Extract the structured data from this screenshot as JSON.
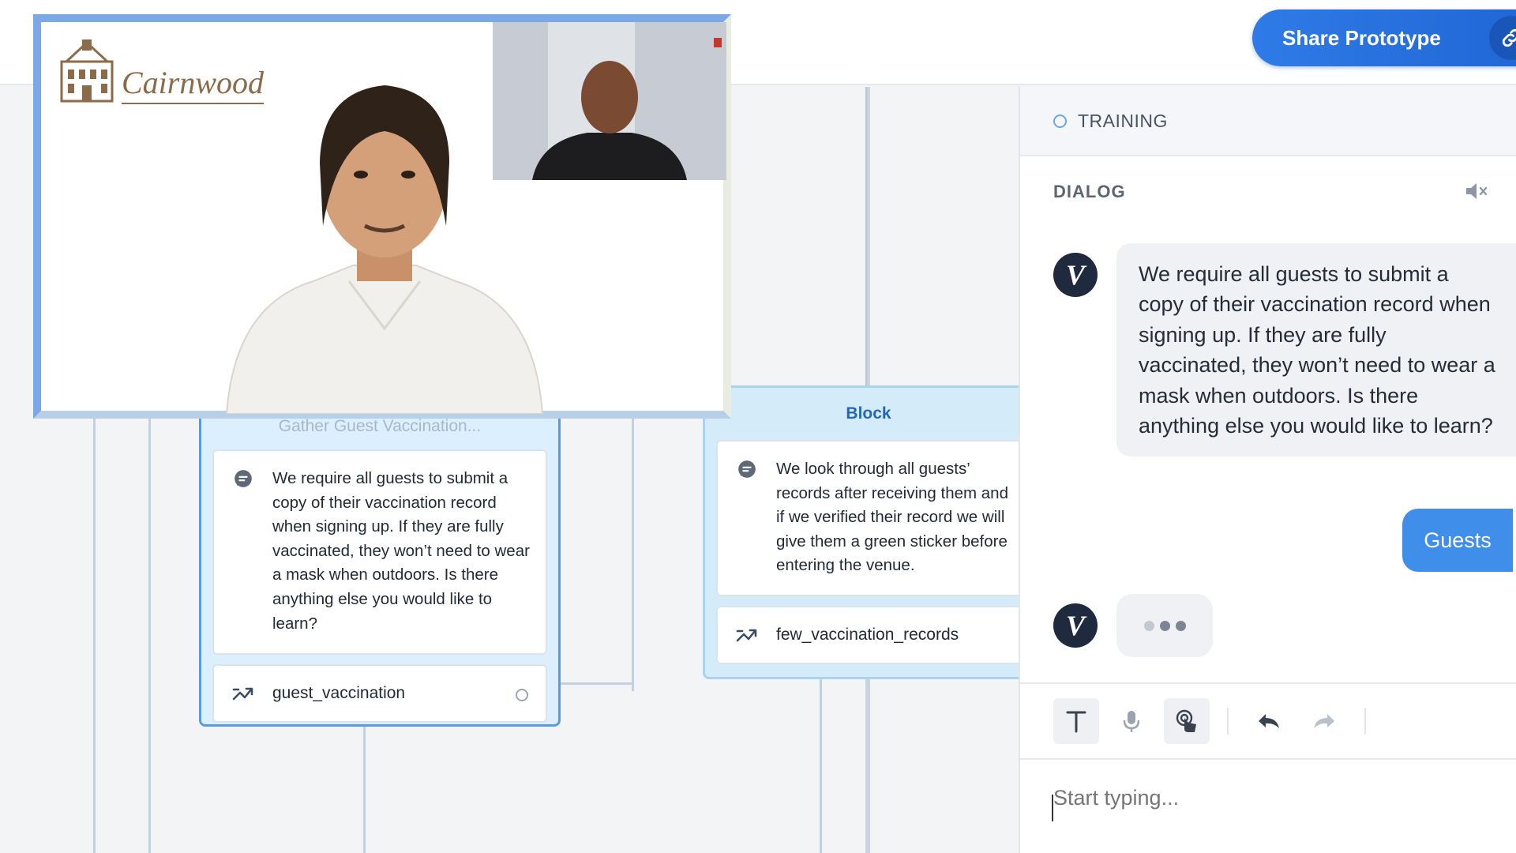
{
  "header": {
    "share_label": "Share Prototype"
  },
  "canvas": {
    "block_left": {
      "title": "Gather Guest Vaccination...",
      "message": "We require all guests to submit a copy of their vaccination record when signing up. If they are fully vaccinated, they won’t need to wear a mask when outdoors. Is there anything else you would like to learn?",
      "choice": "guest_vaccination"
    },
    "block_right": {
      "title": "Block",
      "message": "We look through all guests’ records after receiving them and if we verified their record we will give them a green sticker before entering the venue.",
      "choice": "few_vaccination_records"
    }
  },
  "video": {
    "logo_text": "Cairnwood"
  },
  "panel": {
    "training_label": "TRAINING",
    "dialog_label": "DIALOG",
    "avatar_letter": "V",
    "bot_message": "We require all guests to submit a copy of their vaccination record when signing up. If they are fully vaccinated, they won’t need to wear a mask when outdoors. Is there anything else you would like to learn?",
    "user_message": "Guests",
    "input_placeholder": "Start typing..."
  },
  "colors": {
    "accent": "#2f7be6",
    "user_bubble": "#3f8ee9",
    "block_bg": "#d4ecf9",
    "avatar_bg": "#1f2a3f"
  },
  "icons": [
    "link-icon",
    "message-icon",
    "shuffle-icon",
    "mute-icon",
    "text-icon",
    "mic-icon",
    "touch-icon",
    "undo-icon",
    "redo-icon"
  ]
}
